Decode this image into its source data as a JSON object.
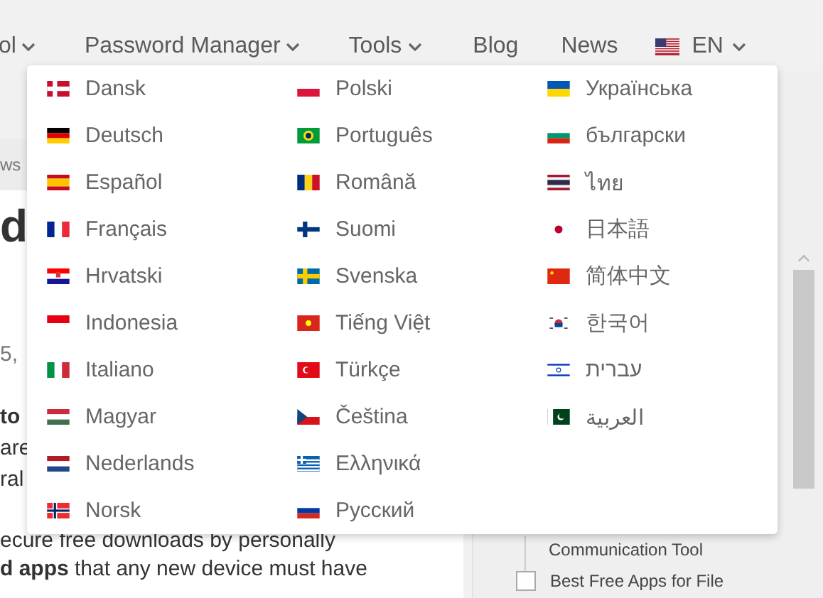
{
  "nav": {
    "items": [
      {
        "label": "ol",
        "dropdown": true
      },
      {
        "label": "Password Manager",
        "dropdown": true
      },
      {
        "label": "Tools",
        "dropdown": true
      },
      {
        "label": "Blog",
        "dropdown": false
      },
      {
        "label": "News",
        "dropdown": false
      }
    ],
    "language_button": {
      "label": "EN",
      "expanded": true
    }
  },
  "language_menu": [
    {
      "label": "Dansk"
    },
    {
      "label": "Deutsch"
    },
    {
      "label": "Español"
    },
    {
      "label": "Français"
    },
    {
      "label": "Hrvatski"
    },
    {
      "label": "Indonesia"
    },
    {
      "label": "Italiano"
    },
    {
      "label": "Magyar"
    },
    {
      "label": "Nederlands"
    },
    {
      "label": "Norsk"
    },
    {
      "label": "Polski"
    },
    {
      "label": "Português"
    },
    {
      "label": "Română"
    },
    {
      "label": "Suomi"
    },
    {
      "label": "Svenska"
    },
    {
      "label": "Tiếng Việt"
    },
    {
      "label": "Türkçe"
    },
    {
      "label": "Čeština"
    },
    {
      "label": "Ελληνικά"
    },
    {
      "label": "Русский"
    },
    {
      "label": "Українська"
    },
    {
      "label": "български"
    },
    {
      "label": "ไทย"
    },
    {
      "label": "日本語"
    },
    {
      "label": "简体中文"
    },
    {
      "label": "한국어"
    },
    {
      "label": "עברית"
    },
    {
      "label": "العربية"
    }
  ],
  "breadcrumb": "ws",
  "article": {
    "title": "d",
    "date": "5,",
    "paragraphs": [
      [
        "**to**",
        "are",
        "ral"
      ],
      [
        "ecure free downloads by personally",
        "**d apps** that any new device must have"
      ]
    ]
  },
  "sidebar": {
    "items": [
      {
        "label": "Communication Tool",
        "kind": "continued"
      },
      {
        "label": "Best Free Apps for File",
        "checked": false,
        "kind": "checkbox"
      }
    ]
  }
}
